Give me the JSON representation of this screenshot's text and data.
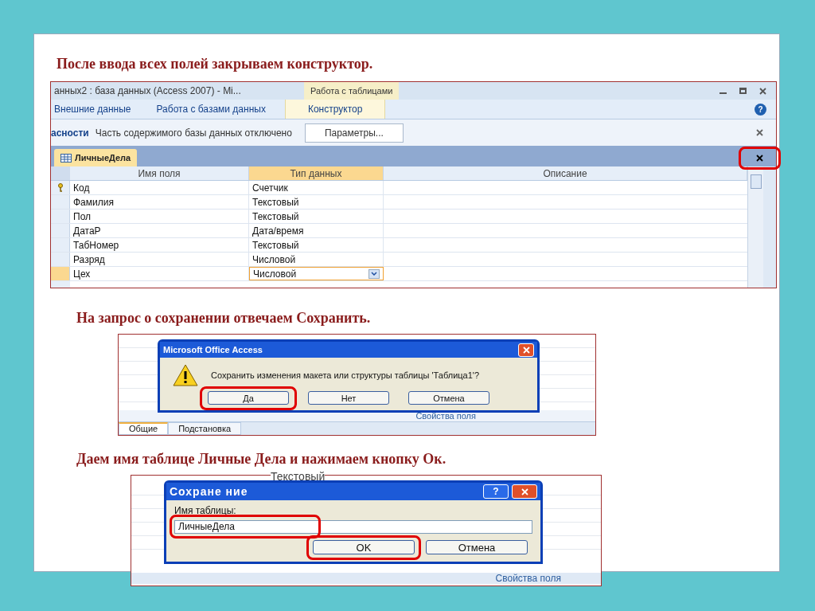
{
  "slide": {
    "heading_1": "После ввода всех полей закрываем конструктор.",
    "heading_2": "На запрос о сохранении отвечаем Сохранить.",
    "heading_3": "Даем имя таблице Личные Дела и нажимаем кнопку Ок."
  },
  "access_window": {
    "title": "анных2 : база данных (Access 2007) - Mi...",
    "context_tab": "Работа с таблицами",
    "help_label": "?",
    "ribbon_tabs": [
      {
        "label": "Внешние данные",
        "selected": false
      },
      {
        "label": "Работа с базами данных",
        "selected": false
      },
      {
        "label": "Конструктор",
        "selected": true
      }
    ],
    "message_bar": {
      "title": "асности",
      "text": "Часть содержимого базы данных отключено",
      "button": "Параметры..."
    },
    "document_tab": {
      "label": "ЛичныеДела",
      "close_highlighted": true
    },
    "columns": [
      "Имя поля",
      "Тип данных",
      "Описание"
    ],
    "rows": [
      {
        "name": "Код",
        "type": "Счетчик",
        "key": true,
        "selected": false
      },
      {
        "name": "Фамилия",
        "type": "Текстовый",
        "key": false,
        "selected": false
      },
      {
        "name": "Пол",
        "type": "Текстовый",
        "key": false,
        "selected": false
      },
      {
        "name": "ДатаР",
        "type": "Дата/время",
        "key": false,
        "selected": false
      },
      {
        "name": "ТабНомер",
        "type": "Текстовый",
        "key": false,
        "selected": false
      },
      {
        "name": "Разряд",
        "type": "Числовой",
        "key": false,
        "selected": false
      },
      {
        "name": "Цех",
        "type": "Числовой",
        "key": false,
        "selected": true
      }
    ]
  },
  "save_prompt": {
    "title": "Microsoft Office Access",
    "message": "Сохранить изменения макета или структуры таблицы 'Таблица1'?",
    "buttons": [
      {
        "label": "Да",
        "highlighted": true
      },
      {
        "label": "Нет",
        "highlighted": false
      },
      {
        "label": "Отмена",
        "highlighted": false
      }
    ],
    "section_label": "Свойства поля",
    "tabs": [
      {
        "label": "Общие",
        "selected": true
      },
      {
        "label": "Подстановка",
        "selected": false
      }
    ]
  },
  "save_as": {
    "background_cell": "Текстовый",
    "title": "Сохране ние",
    "help_button": "?",
    "field_label": "Имя таблицы:",
    "field_value": "ЛичныеДела",
    "field_highlighted": true,
    "buttons": [
      {
        "label": "OK",
        "highlighted": true
      },
      {
        "label": "Отмена",
        "highlighted": false
      }
    ],
    "section_label": "Свойства поля"
  }
}
